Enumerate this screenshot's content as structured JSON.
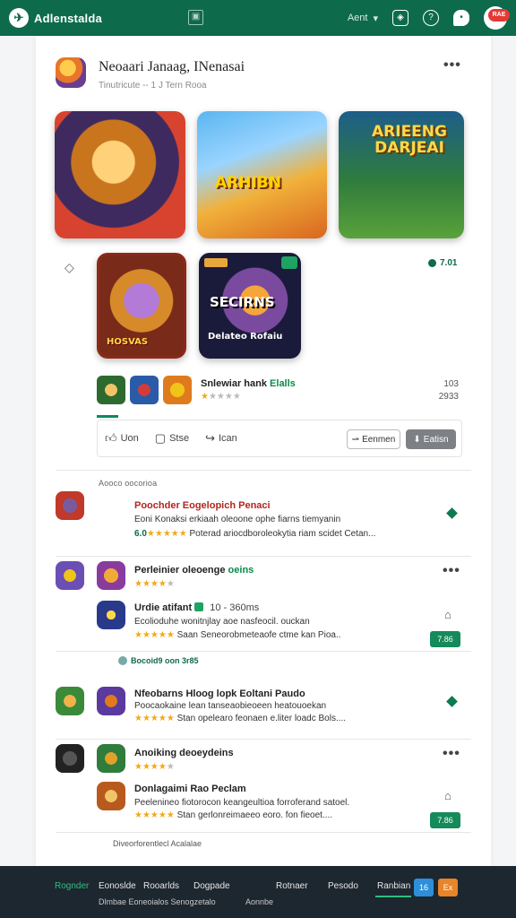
{
  "topbar": {
    "brand": "Adlenstalda",
    "account": "Aent",
    "avatar_badge": "RAE"
  },
  "app": {
    "title": "Neoaari Janaag, INenasai",
    "subtitle": "Tinutricute -- 1 J Tern Rooa",
    "screenshot_titles": [
      "ARHIBN",
      "ARIEENG DARJEAI",
      "HOSVAS",
      "SECIRNS",
      "Delateo Rofaiu"
    ],
    "rating_chip": "7.01",
    "mini_title": "Snlewiar hank",
    "mini_title_highlight": "Elalls",
    "mini_stars": "★",
    "mini_stars_empty": "★★★★",
    "mini_nums": [
      "103",
      "2933"
    ],
    "actions": {
      "like": "Uon",
      "share": "Stse",
      "forward": "Ican",
      "outline_button": "Eenmen",
      "gray_button": "Eatisn"
    }
  },
  "list": {
    "section_label": "Aooco oocorioa",
    "items": [
      {
        "title": "Poochder Eogelopich Penaci",
        "desc": "Eoni Konaksi erkiaah oleoone ophe fiarns tiemyanin",
        "stars": "★★★★★",
        "rating_text": "6.0",
        "meta": "Poterad ariocdboroleokytia riam scidet Cetan..."
      },
      {
        "title": "Perleinier oleoenge",
        "title_green": "oeins",
        "stars": "★★★★",
        "stars_empty": "★"
      },
      {
        "title": "Urdie atifant",
        "title_extra": "10 - 360ms",
        "desc": "Ecolioduhe wonitnjlay aoe nasfeocil. ouckan",
        "stars": "★★★★★",
        "meta": "Saan Seneorobmeteaofe ctme kan Pioa..",
        "button": "7.86"
      },
      {
        "sub_label": "Bocoid9 oon 3r85",
        "title": "Nfeobarns Hloog lopk Eoltani Paudo",
        "desc": "Poocaokaine lean tanseaobieoeen heatouoekan",
        "stars": "★★★★★",
        "meta": "Stan opelearo feonaen e.liter loadc Bols...."
      },
      {
        "title": "Anoiking deoeydeins",
        "stars": "★★★★",
        "stars_empty": "★"
      },
      {
        "title": "Donlagaimi Rao Peclam",
        "desc": "Peelenineo fiotorocon keangeultioa forroferand satoel.",
        "stars": "★★★★★",
        "meta": "Stan gerlonreimaeeo eoro. fon fieoet....",
        "button": "7.86"
      }
    ],
    "footer_note": "Diveorforentlecl Acalalae"
  },
  "bottombar": {
    "nav": [
      "Rognder",
      "Eonoslde",
      "Rooarlds",
      "Dogpade",
      "Rotnaer",
      "Pesodo",
      "Ranbian"
    ],
    "nav_second": "Dlmbae Eoneoialos Senogzetalo",
    "nav_second_extra": "Aonnbe",
    "blue_tile": "16",
    "orange_tile": "Ex"
  },
  "colors": {
    "brand_green": "#0d6b4c",
    "accent_green": "#158a5a",
    "title_red": "#b3261e",
    "star": "#f2a91a",
    "bottom_bg": "#1d2730"
  }
}
